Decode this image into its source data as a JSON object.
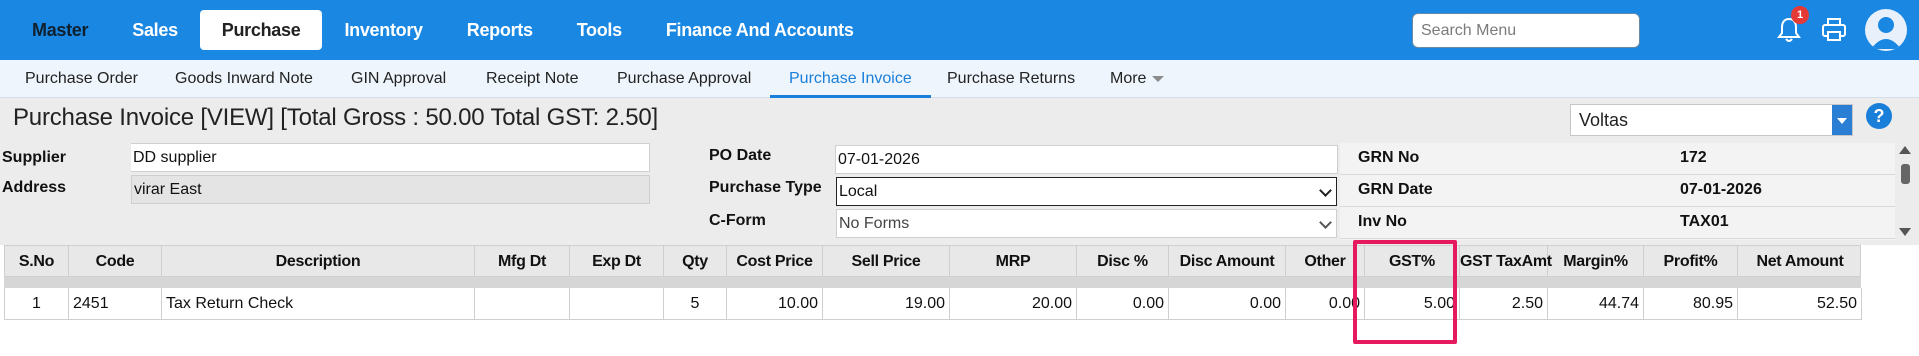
{
  "topnav": {
    "items": [
      "Master",
      "Sales",
      "Purchase",
      "Inventory",
      "Reports",
      "Tools",
      "Finance And Accounts"
    ],
    "active_index": 2,
    "search_placeholder": "Search Menu",
    "notification_count": "1",
    "icons": [
      "bell-icon",
      "printer-icon",
      "user-avatar-icon"
    ]
  },
  "subnav": {
    "items": [
      "Purchase Order",
      "Goods Inward Note",
      "GIN Approval",
      "Receipt Note",
      "Purchase Approval",
      "Purchase Invoice",
      "Purchase Returns",
      "More"
    ],
    "active_index": 5
  },
  "header": {
    "title": "Purchase Invoice [VIEW] [Total Gross : 50.00 Total GST: 2.50]",
    "branch": "Voltas",
    "help": "?"
  },
  "form": {
    "supplier_label": "Supplier",
    "supplier_value": "DD supplier",
    "address_label": "Address",
    "address_value": "virar East",
    "po_date_label": "PO Date",
    "po_date_value": "07-01-2026",
    "purchase_type_label": "Purchase Type",
    "purchase_type_value": "Local",
    "cform_label": "C-Form",
    "cform_value": "No Forms",
    "grn_no_label": "GRN No",
    "grn_no_value": "172",
    "grn_date_label": "GRN Date",
    "grn_date_value": "07-01-2026",
    "inv_no_label": "Inv No",
    "inv_no_value": "TAX01"
  },
  "table": {
    "columns": [
      "S.No",
      "Code",
      "Description",
      "Mfg Dt",
      "Exp Dt",
      "Qty",
      "Cost Price",
      "Sell Price",
      "MRP",
      "Disc %",
      "Disc Amount",
      "Other",
      "GST%",
      "GST TaxAmt",
      "Margin%",
      "Profit%",
      "Net Amount"
    ],
    "rows": [
      [
        "1",
        "2451",
        "Tax Return Check",
        "",
        "",
        "5",
        "10.00",
        "19.00",
        "20.00",
        "0.00",
        "0.00",
        "0.00",
        "5.00",
        "2.50",
        "44.74",
        "80.95",
        "52.50"
      ]
    ],
    "highlighted_column": "GST%"
  },
  "colors": {
    "topbar": "#1a88e3",
    "active_tab": "#1a7fd9",
    "highlight_box": "#e5195e",
    "notification_badge": "#e53935"
  }
}
